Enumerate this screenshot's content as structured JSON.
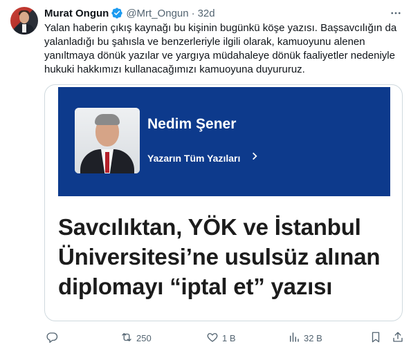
{
  "tweet": {
    "author_name": "Murat Ongun",
    "handle": "@Mrt_Ongun",
    "separator": "·",
    "time": "32d",
    "text_lines": [
      "Yalan haberin çıkış kaynağı bu kişinin bugünkü köşe yazısı. Başsavcılığın da",
      "yalanladığı bu şahısla ve benzerleriyle ilgili olarak, kamuoyunu alenen",
      "yanıltmaya dönük yazılar ve yargıya müdahaleye dönük faaliyetler nedeniyle",
      "hukuki hakkımızı kullanacağımızı kamuoyuna duyururuz."
    ],
    "card": {
      "author": "Nedim Şener",
      "all_posts": "Yazarın Tüm Yazıları",
      "headline_lines": [
        "Savcılıktan, YÖK ve İstanbul",
        "Üniversitesi’ne usulsüz alınan",
        "diplomayı “iptal et” yazısı"
      ]
    },
    "actions": {
      "retweets": "250",
      "likes": "1 B",
      "views": "32 B"
    }
  },
  "colors": {
    "accent": "#1d9bf0",
    "muted": "#536471",
    "banner": "#0d3a8c"
  },
  "icons": [
    "verified-badge-icon",
    "more-icon",
    "reply-icon",
    "retweet-icon",
    "like-icon",
    "views-icon",
    "bookmark-icon",
    "share-icon"
  ]
}
